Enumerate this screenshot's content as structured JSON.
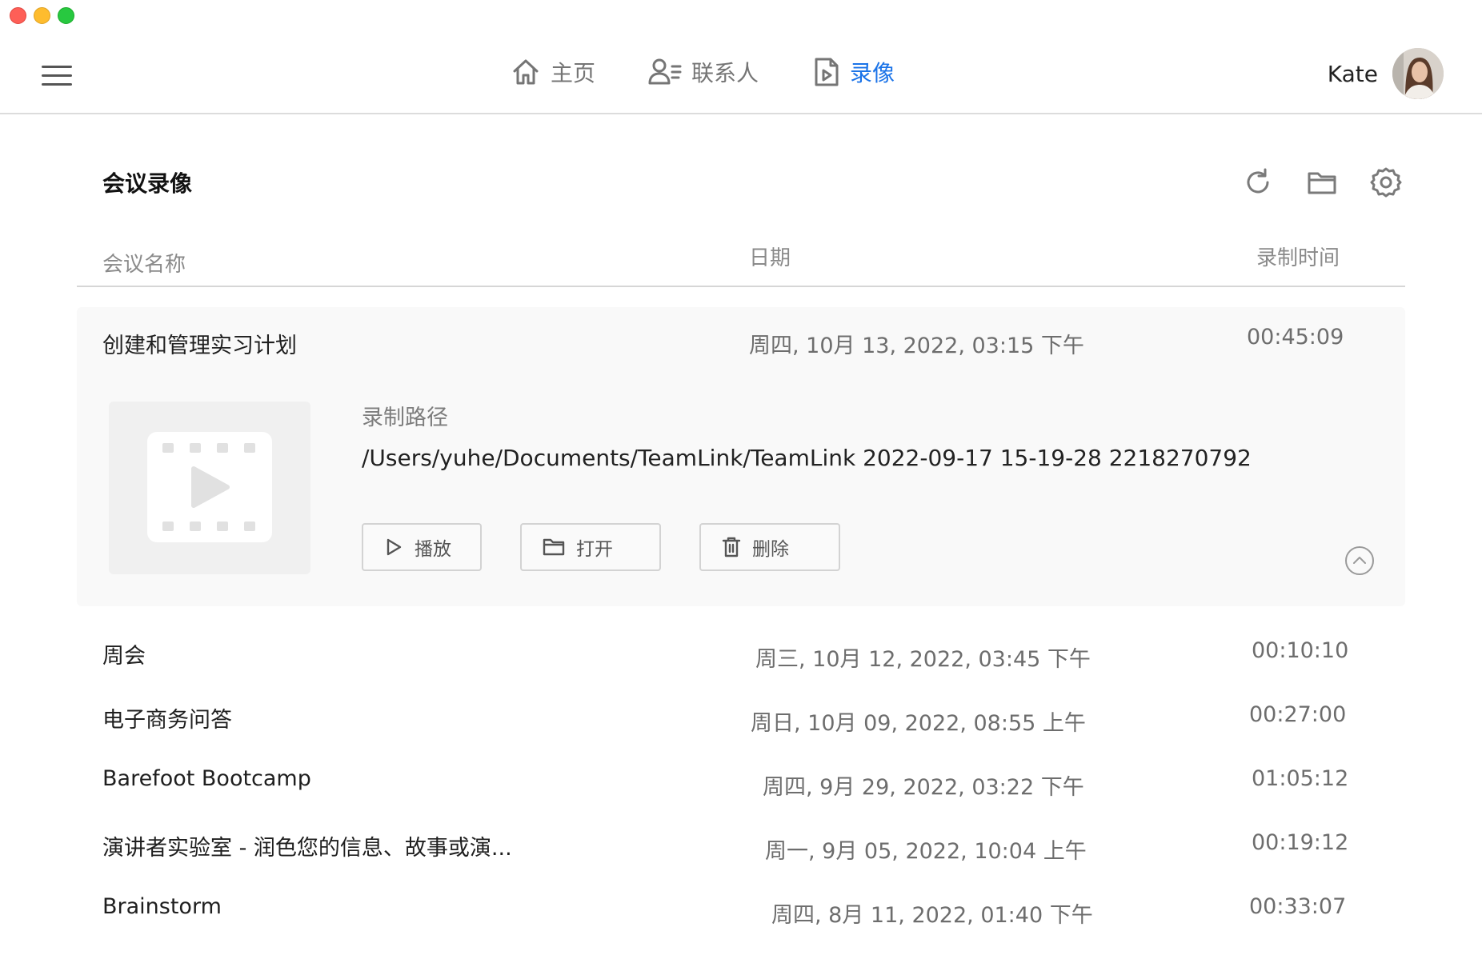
{
  "window": {
    "controls": [
      "close",
      "minimize",
      "zoom"
    ]
  },
  "nav": {
    "items": [
      {
        "label": "主页",
        "icon": "home-icon",
        "active": false
      },
      {
        "label": "联系人",
        "icon": "contacts-icon",
        "active": false
      },
      {
        "label": "录像",
        "icon": "recording-file-icon",
        "active": true
      }
    ]
  },
  "user": {
    "name": "Kate",
    "avatar": "avatar-photo"
  },
  "page": {
    "title": "会议录像",
    "toolbar": [
      "refresh-icon",
      "folder-icon",
      "settings-icon"
    ]
  },
  "table": {
    "columns": [
      "会议名称",
      "日期",
      "录制时间"
    ]
  },
  "expanded": {
    "name": "创建和管理实习计划",
    "date": "周四, 10月 13, 2022, 03:15 下午",
    "duration": "00:45:09",
    "path_label": "录制路径",
    "path_value": "/Users/yuhe/Documents/TeamLink/TeamLink 2022-09-17 15-19-28 2218270792",
    "actions": [
      {
        "label": "播放",
        "icon": "play-icon"
      },
      {
        "label": "打开",
        "icon": "folder-icon"
      },
      {
        "label": "删除",
        "icon": "trash-icon"
      }
    ]
  },
  "recordings": [
    {
      "name": "周会",
      "date": "周三, 10月 12, 2022, 03:45 下午",
      "duration": "00:10:10"
    },
    {
      "name": "电子商务问答",
      "date": "周日, 10月 09, 2022, 08:55 上午",
      "duration": "00:27:00"
    },
    {
      "name": "Barefoot Bootcamp",
      "date": "周四, 9月 29, 2022, 03:22 下午",
      "duration": "01:05:12"
    },
    {
      "name": "演讲者实验室 - 润色您的信息、故事或演...",
      "date": "周一, 9月 05, 2022, 10:04 上午",
      "duration": "00:19:12"
    },
    {
      "name": "Brainstorm",
      "date": "周四, 8月 11, 2022, 01:40 下午",
      "duration": "00:33:07"
    }
  ],
  "colors": {
    "accent": "#1a73e8",
    "expanded_bg": "#f9f9f9",
    "divider": "#d6d6d6"
  }
}
